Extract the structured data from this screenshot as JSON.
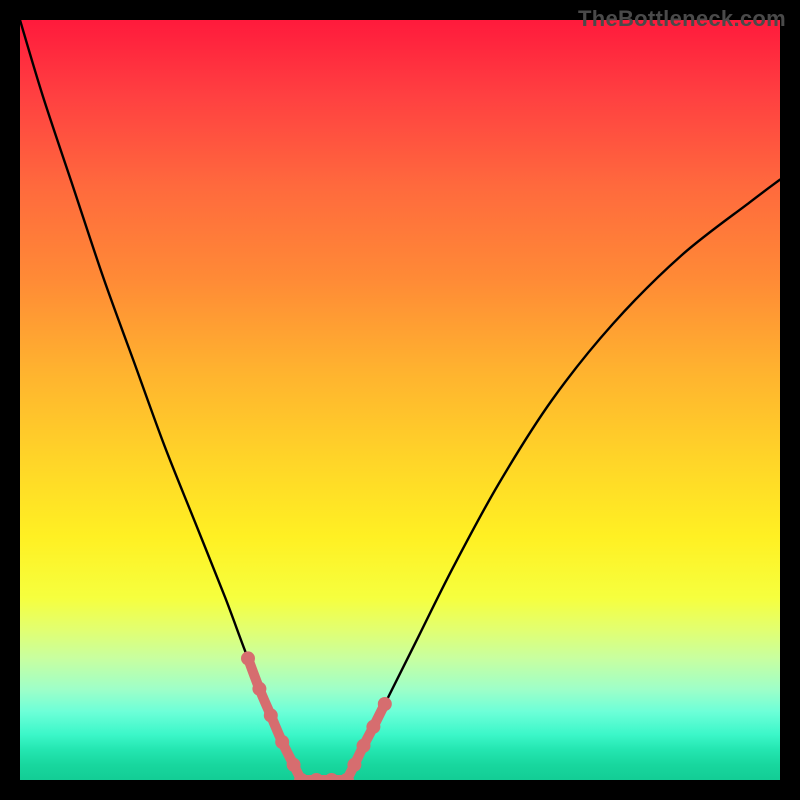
{
  "watermark": "TheBottleneck.com",
  "chart_data": {
    "type": "line",
    "title": "",
    "xlabel": "",
    "ylabel": "",
    "xlim": [
      0,
      100
    ],
    "ylim": [
      0,
      100
    ],
    "series": [
      {
        "name": "left-branch",
        "x": [
          0,
          3,
          7,
          11,
          15,
          19,
          23,
          27,
          30,
          33,
          35,
          37
        ],
        "y": [
          100,
          90,
          78,
          66,
          55,
          44,
          34,
          24,
          16,
          9,
          4,
          0
        ]
      },
      {
        "name": "right-branch",
        "x": [
          43,
          45,
          48,
          52,
          57,
          63,
          70,
          78,
          87,
          96,
          100
        ],
        "y": [
          0,
          4,
          10,
          18,
          28,
          39,
          50,
          60,
          69,
          76,
          79
        ]
      },
      {
        "name": "left-highlight",
        "x": [
          30,
          31.5,
          33,
          34.5,
          36,
          37
        ],
        "y": [
          16,
          12,
          8.5,
          5,
          2,
          0
        ]
      },
      {
        "name": "right-highlight",
        "x": [
          43,
          44,
          45.2,
          46.5,
          48
        ],
        "y": [
          0,
          2,
          4.5,
          7,
          10
        ]
      },
      {
        "name": "valley-floor",
        "x": [
          37,
          39,
          41,
          43
        ],
        "y": [
          0,
          0,
          0,
          0
        ]
      }
    ],
    "gradient_bands": [
      {
        "pos": 0,
        "color": "#ff1a3c"
      },
      {
        "pos": 0.22,
        "color": "#ff6a3d"
      },
      {
        "pos": 0.46,
        "color": "#ffb22f"
      },
      {
        "pos": 0.68,
        "color": "#fff023"
      },
      {
        "pos": 0.88,
        "color": "#9fffc8"
      },
      {
        "pos": 1.0,
        "color": "#13cd95"
      }
    ]
  }
}
